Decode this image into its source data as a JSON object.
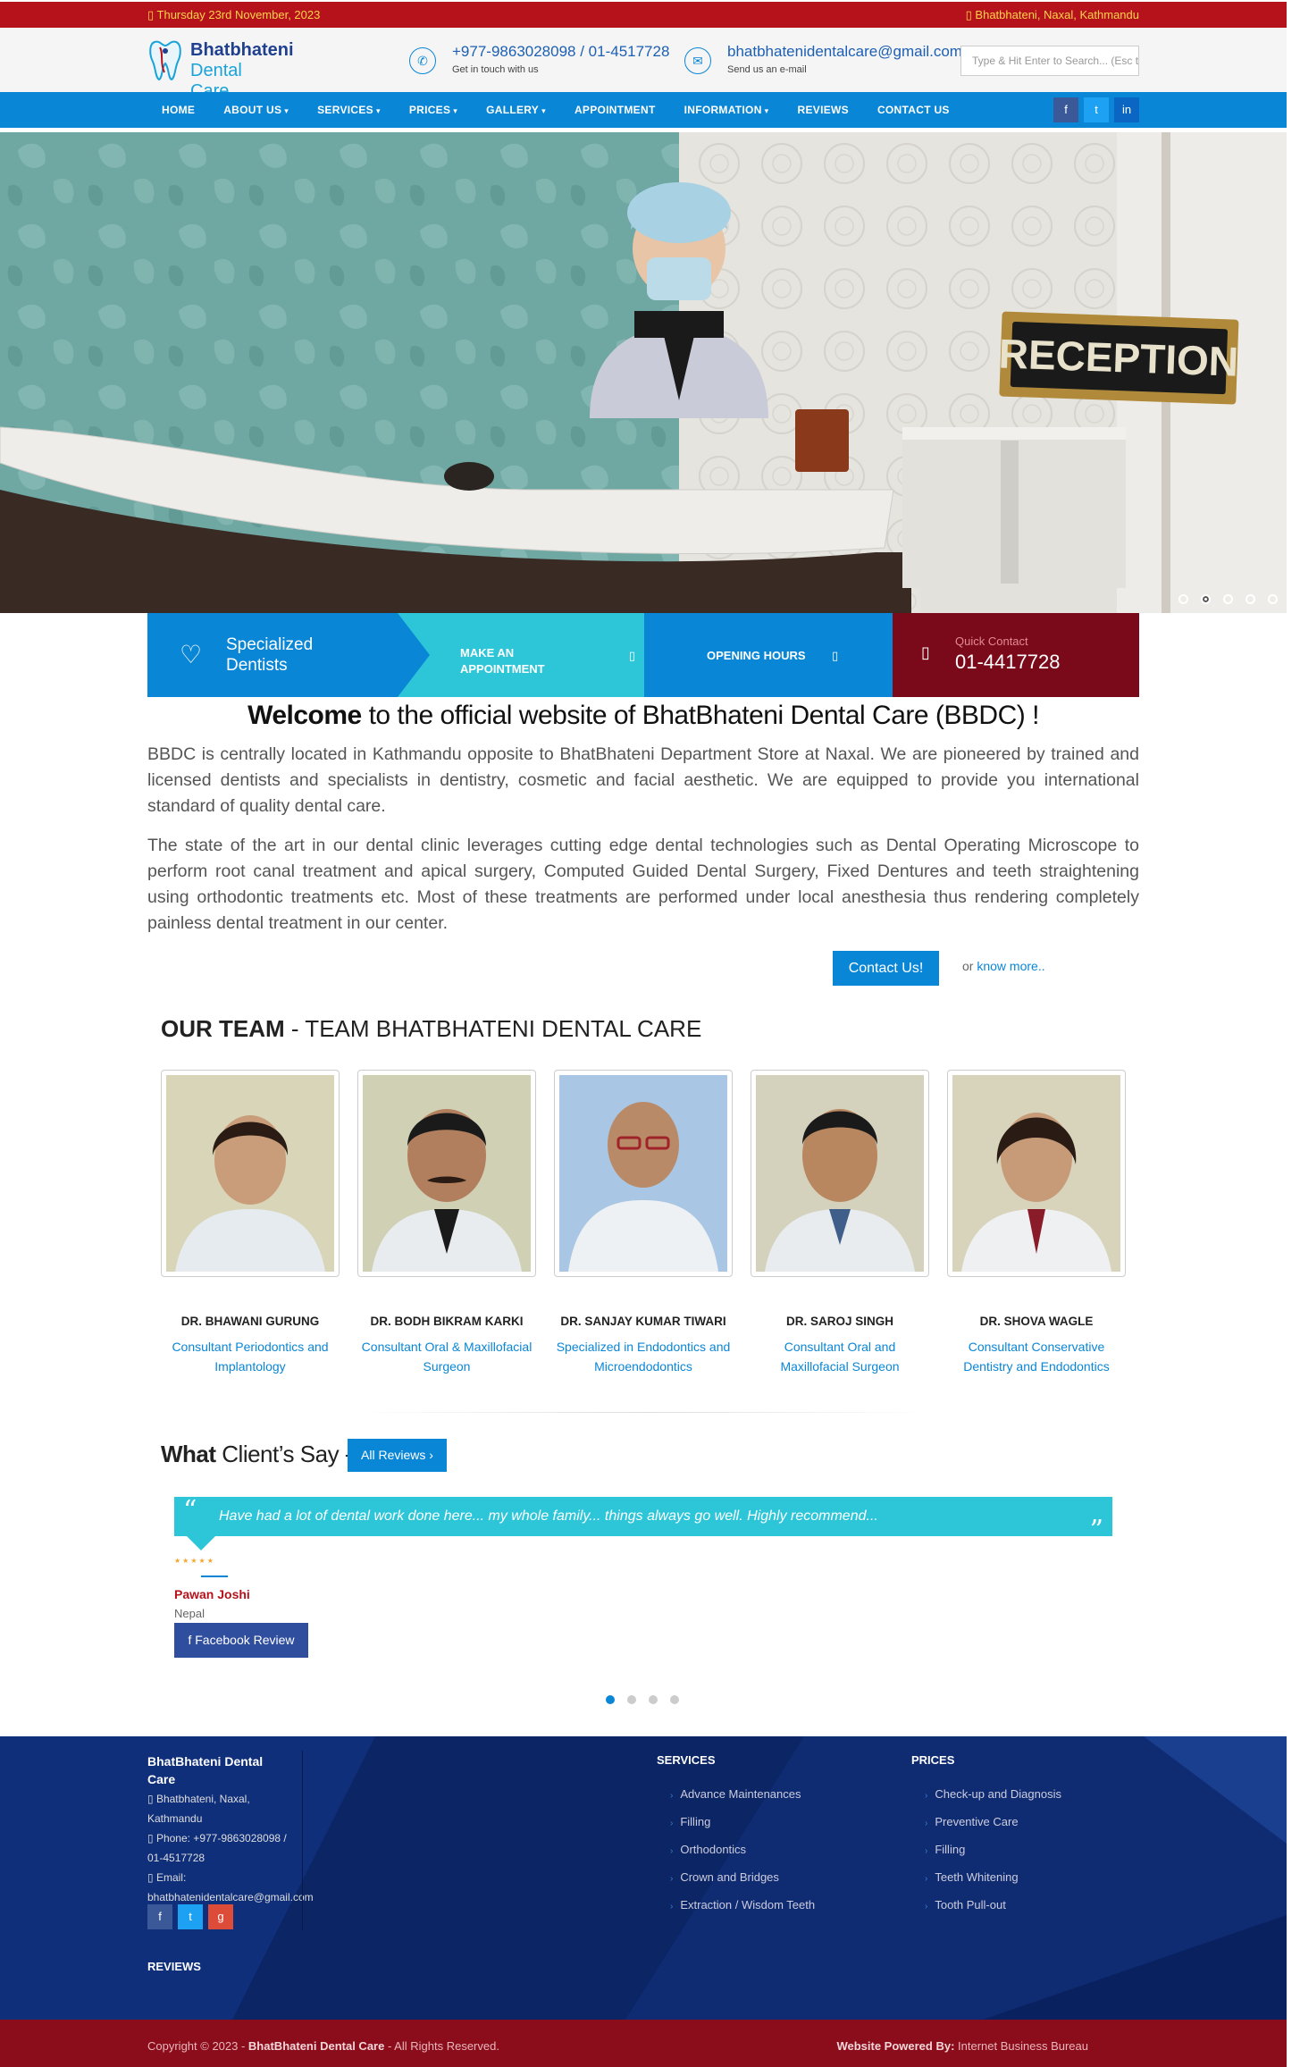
{
  "topbar": {
    "date": "Thursday 23rd November, 2023",
    "location": "Bhatbhateni, Naxal, Kathmandu"
  },
  "logo": {
    "line1": "Bhatbhateni",
    "line2": "Dental Care"
  },
  "header": {
    "phone": "+977-9863028098 / 01-4517728",
    "phone_sub": "Get in touch with us",
    "email": "bhatbhatenidentalcare@gmail.com",
    "email_sub": "Send us an e-mail",
    "search_placeholder": "Type & Hit Enter to Search... (Esc to close)"
  },
  "nav": [
    {
      "label": "HOME",
      "dropdown": false
    },
    {
      "label": "ABOUT US",
      "dropdown": true
    },
    {
      "label": "SERVICES",
      "dropdown": true
    },
    {
      "label": "PRICES",
      "dropdown": true
    },
    {
      "label": "GALLERY",
      "dropdown": true
    },
    {
      "label": "APPOINTMENT",
      "dropdown": false
    },
    {
      "label": "INFORMATION",
      "dropdown": true
    },
    {
      "label": "REVIEWS",
      "dropdown": false
    },
    {
      "label": "CONTACT US",
      "dropdown": false
    }
  ],
  "social_colors": {
    "facebook": "#3b5998",
    "twitter": "#1da1f2",
    "linkedin": "#0a66c2",
    "google": "#dd4b39"
  },
  "hero": {
    "sign_text": "RECEPTION"
  },
  "strip": {
    "specialized": "Specialized Dentists",
    "appointment": "MAKE AN APPOINTMENT",
    "hours": "OPENING HOURS",
    "quick_label": "Quick Contact",
    "quick_phone": "01-4417728"
  },
  "welcome": {
    "bold": "Welcome",
    "rest": " to the official website of BhatBhateni Dental Care (BBDC) !",
    "para1": "BBDC is centrally located in Kathmandu opposite to BhatBhateni Department Store at Naxal. We are pioneered by trained and licensed dentists and specialists in dentistry, cosmetic and facial aesthetic. We are equipped to provide you international standard of quality dental care.",
    "para2": "The state of the art in our dental clinic leverages cutting edge dental technologies such as Dental Operating Microscope to perform root canal treatment and apical surgery, Computed Guided Dental Surgery, Fixed Dentures and teeth straightening using orthodontic treatments etc. Most of these treatments are performed under local anesthesia thus rendering completely painless dental treatment in our center.",
    "contact_btn": "Contact Us!",
    "or": "or ",
    "know_more": "know more.."
  },
  "team": {
    "title_bold": "OUR TEAM",
    "title_rest": " - TEAM BHATBHATENI DENTAL CARE",
    "members": [
      {
        "name": "DR. BHAWANI GURUNG",
        "role": "Consultant Periodontics and Implantology"
      },
      {
        "name": "DR. BODH BIKRAM KARKI",
        "role": "Consultant Oral & Maxillofacial Surgeon"
      },
      {
        "name": "DR. SANJAY KUMAR TIWARI",
        "role": "Specialized in Endodontics and Microendodontics"
      },
      {
        "name": "DR. SAROJ SINGH",
        "role": "Consultant Oral and Maxillofacial Surgeon"
      },
      {
        "name": "DR. SHOVA WAGLE",
        "role": "Consultant Conservative Dentistry and Endodontics"
      }
    ]
  },
  "testimonials": {
    "title_bold": "What",
    "title_rest": " Client’s Say -",
    "all_reviews": "All Reviews",
    "quote": "Have had a lot of dental work done here... my whole family... things always go well. Highly recommend...",
    "rating": 5,
    "reviewer": "Pawan Joshi",
    "reviewer_loc": "Nepal",
    "fb_review": "Facebook Review"
  },
  "footer": {
    "org": "BhatBhateni Dental Care",
    "address": "Bhatbhateni, Naxal, Kathmandu",
    "phone": "Phone: +977-9863028098 / 01-4517728",
    "email_label": "Email:",
    "email": "bhatbhatenidentalcare@gmail.com",
    "services_title": "SERVICES",
    "services": [
      "Advance Maintenances",
      "Filling",
      "Orthodontics",
      "Crown and Bridges",
      "Extraction / Wisdom Teeth"
    ],
    "prices_title": "PRICES",
    "prices": [
      "Check-up and Diagnosis",
      "Preventive Care",
      "Filling",
      "Teeth Whitening",
      "Tooth Pull-out"
    ],
    "reviews_title": "REVIEWS"
  },
  "copyright": {
    "prefix": "Copyright © 2023 - ",
    "org": "BhatBhateni Dental Care",
    "suffix": " - All Rights Reserved.",
    "powered_label": "Website Powered By:",
    "powered_by": " Internet Business Bureau"
  }
}
